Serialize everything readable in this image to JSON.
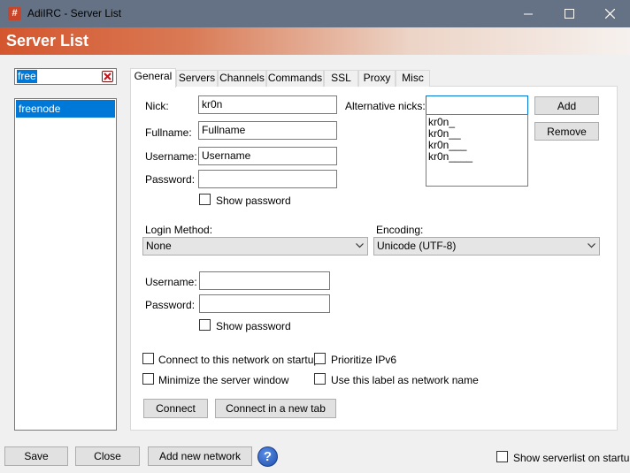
{
  "window": {
    "title": "AdiIRC - Server List",
    "app_icon_glyph": "#"
  },
  "header": {
    "title": "Server List"
  },
  "filter": {
    "value": "free"
  },
  "server_list": {
    "items": [
      "freenode"
    ]
  },
  "tabs": [
    "General",
    "Servers",
    "Channels",
    "Commands",
    "SSL",
    "Proxy",
    "Misc"
  ],
  "general": {
    "nick_label": "Nick:",
    "nick_value": "kr0n",
    "fullname_label": "Fullname:",
    "fullname_value": "Fullname",
    "username_label": "Username:",
    "username_value": "Username",
    "password_label": "Password:",
    "password_value": "",
    "show_password_label": "Show password",
    "alt_nicks_label": "Alternative nicks:",
    "alt_nick_input": "",
    "alt_nicks": [
      "kr0n_",
      "kr0n__",
      "kr0n___",
      "kr0n____"
    ],
    "add_label": "Add",
    "remove_label": "Remove",
    "login_method_label": "Login Method:",
    "login_method_value": "None",
    "encoding_label": "Encoding:",
    "encoding_value": "Unicode (UTF-8)",
    "login_username_label": "Username:",
    "login_username_value": "",
    "login_password_label": "Password:",
    "login_password_value": "",
    "login_show_password_label": "Show password",
    "connect_startup_label": "Connect to this network on startup",
    "prioritize_ipv6_label": "Prioritize IPv6",
    "minimize_label": "Minimize the server window",
    "use_label_label": "Use this label as network name",
    "connect_label": "Connect",
    "connect_new_tab_label": "Connect in a new tab"
  },
  "footer": {
    "save_label": "Save",
    "close_label": "Close",
    "add_network_label": "Add new network",
    "help_glyph": "?",
    "show_on_startup_label": "Show serverlist on startup"
  },
  "colors": {
    "selection": "#0078d7",
    "titlebar": "#657285",
    "banner": "#d4562e"
  }
}
